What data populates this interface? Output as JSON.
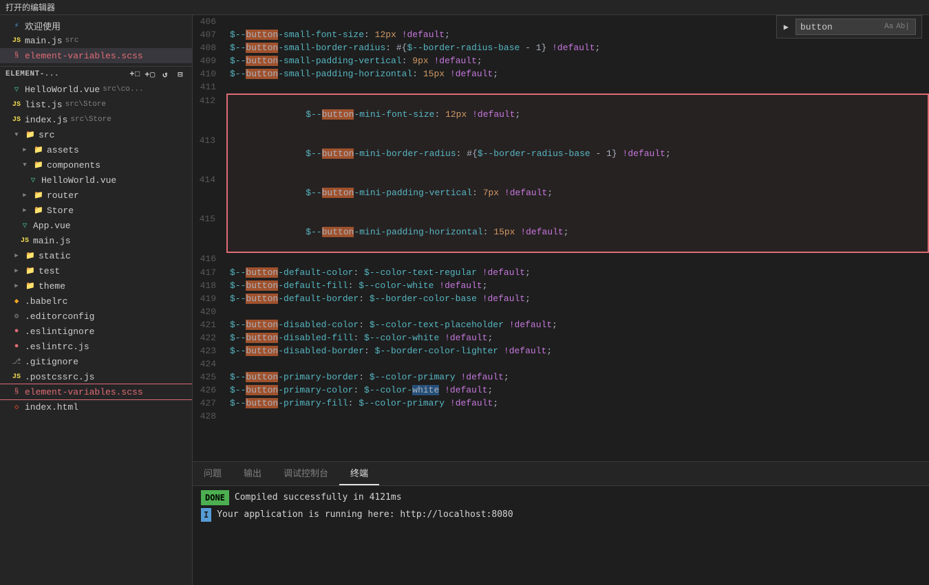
{
  "topbar": {
    "title": "打开的编辑器"
  },
  "sidebar": {
    "open_editors": [
      {
        "id": "welcome",
        "label": "欢迎使用",
        "icon": "vscode",
        "indent": 1
      },
      {
        "id": "main-js",
        "label": "main.js",
        "sublabel": "src",
        "icon": "js",
        "indent": 1
      },
      {
        "id": "element-variables-scss-top",
        "label": "element-variables.scss",
        "icon": "scss",
        "indent": 1,
        "active": true
      }
    ],
    "project_header": "ELEMENT-...",
    "toolbar_icons": [
      "new-file",
      "new-folder",
      "refresh",
      "collapse"
    ],
    "tree": [
      {
        "id": "src",
        "label": "src",
        "icon": "folder-open",
        "indent": 1,
        "expanded": true
      },
      {
        "id": "assets",
        "label": "assets",
        "icon": "folder",
        "indent": 2,
        "expanded": false
      },
      {
        "id": "components",
        "label": "components",
        "icon": "folder-open",
        "indent": 2,
        "expanded": true
      },
      {
        "id": "hello-world-vue",
        "label": "HelloWorld.vue",
        "icon": "vue",
        "indent": 3
      },
      {
        "id": "router",
        "label": "router",
        "icon": "folder",
        "indent": 2,
        "expanded": false
      },
      {
        "id": "store",
        "label": "Store",
        "icon": "folder",
        "indent": 2,
        "expanded": false
      },
      {
        "id": "app-vue",
        "label": "App.vue",
        "icon": "vue",
        "indent": 2
      },
      {
        "id": "main-js-tree",
        "label": "main.js",
        "icon": "js",
        "indent": 2
      },
      {
        "id": "static",
        "label": "static",
        "icon": "folder",
        "indent": 1,
        "expanded": false
      },
      {
        "id": "test",
        "label": "test",
        "icon": "folder",
        "indent": 1,
        "expanded": false
      },
      {
        "id": "theme",
        "label": "theme",
        "icon": "folder",
        "indent": 1,
        "expanded": false
      },
      {
        "id": "babelrc",
        "label": ".babelrc",
        "icon": "babel",
        "indent": 1
      },
      {
        "id": "editorconfig",
        "label": ".editorconfig",
        "icon": "gear",
        "indent": 1
      },
      {
        "id": "eslintignore",
        "label": ".eslintignore",
        "icon": "eslint",
        "indent": 1
      },
      {
        "id": "eslintrc-js",
        "label": ".eslintrc.js",
        "icon": "eslint",
        "indent": 1
      },
      {
        "id": "gitignore",
        "label": ".gitignore",
        "icon": "git",
        "indent": 1
      },
      {
        "id": "postcssrc-js",
        "label": ".postcssrc.js",
        "icon": "js",
        "indent": 1
      },
      {
        "id": "element-variables-scss-bottom",
        "label": "element-variables.scss",
        "icon": "scss",
        "indent": 1,
        "selected_border": true
      }
    ]
  },
  "search": {
    "value": "button",
    "placeholder": "button"
  },
  "editor": {
    "lines": [
      {
        "num": 406,
        "content": "",
        "parts": []
      },
      {
        "num": 407,
        "content": "$--button-small-font-size: 12px !default;",
        "highlight_words": [
          "button"
        ]
      },
      {
        "num": 408,
        "content": "$--button-small-border-radius: #{$--border-radius-base - 1} !default;",
        "highlight_words": [
          "button"
        ]
      },
      {
        "num": 409,
        "content": "$--button-small-padding-vertical: 9px !default;",
        "highlight_words": [
          "button"
        ]
      },
      {
        "num": 410,
        "content": "$--button-small-padding-horizontal: 15px !default;",
        "highlight_words": [
          "button"
        ]
      },
      {
        "num": 411,
        "content": "",
        "parts": []
      },
      {
        "num": 412,
        "content": "$--button-mini-font-size: 12px !default;",
        "highlight_words": [
          "button"
        ],
        "box_start": true
      },
      {
        "num": 413,
        "content": "$--button-mini-border-radius: #{$--border-radius-base - 1} !default;",
        "highlight_words": [
          "button"
        ],
        "boxed": true
      },
      {
        "num": 414,
        "content": "$--button-mini-padding-vertical: 7px !default;",
        "highlight_words": [
          "button"
        ],
        "boxed": true
      },
      {
        "num": 415,
        "content": "$--button-mini-padding-horizontal: 15px !default;",
        "highlight_words": [
          "button"
        ],
        "box_end": true
      },
      {
        "num": 416,
        "content": "",
        "parts": []
      },
      {
        "num": 417,
        "content": "$--button-default-color: $--color-text-regular !default;",
        "highlight_words": [
          "button"
        ]
      },
      {
        "num": 418,
        "content": "$--button-default-fill: $--color-white !default;",
        "highlight_words": [
          "button"
        ]
      },
      {
        "num": 419,
        "content": "$--button-default-border: $--border-color-base !default;",
        "highlight_words": [
          "button"
        ]
      },
      {
        "num": 420,
        "content": "",
        "parts": []
      },
      {
        "num": 421,
        "content": "$--button-disabled-color: $--color-text-placeholder !default;",
        "highlight_words": [
          "button"
        ]
      },
      {
        "num": 422,
        "content": "$--button-disabled-fill: $--color-white !default;",
        "highlight_words": [
          "button"
        ]
      },
      {
        "num": 423,
        "content": "$--button-disabled-border: $--border-color-lighter !default;",
        "highlight_words": [
          "button"
        ]
      },
      {
        "num": 424,
        "content": "",
        "parts": []
      },
      {
        "num": 425,
        "content": "$--button-primary-border: $--color-primary !default;",
        "highlight_words": [
          "button"
        ]
      },
      {
        "num": 426,
        "content": "$--button-primary-color: $--color-white !default;",
        "highlight_words": [
          "button"
        ],
        "highlight_white": true
      },
      {
        "num": 427,
        "content": "$--button-primary-fill: $--color-primary !default;",
        "highlight_words": [
          "button"
        ]
      },
      {
        "num": 428,
        "content": "",
        "parts": []
      }
    ]
  },
  "panel": {
    "tabs": [
      {
        "id": "problems",
        "label": "问题",
        "active": false
      },
      {
        "id": "output",
        "label": "输出",
        "active": false
      },
      {
        "id": "debug-console",
        "label": "调试控制台",
        "active": false
      },
      {
        "id": "terminal",
        "label": "终端",
        "active": true
      }
    ],
    "terminal_lines": [
      {
        "type": "done",
        "badge": "DONE",
        "text": "Compiled successfully in 4121ms"
      },
      {
        "type": "info",
        "cursor": "I",
        "text": "Your application is running here: http://localhost:8080"
      }
    ]
  },
  "icons": {
    "vscode": "⚡",
    "js": "JS",
    "scss": "§",
    "vue": "▽",
    "folder": "▶",
    "folder_open": "▼",
    "gear": "⚙",
    "eslint": "●",
    "babel": "◆",
    "git": "⎇",
    "new_file": "□+",
    "new_folder": "📁",
    "refresh": "↺",
    "collapse": "⊟"
  }
}
